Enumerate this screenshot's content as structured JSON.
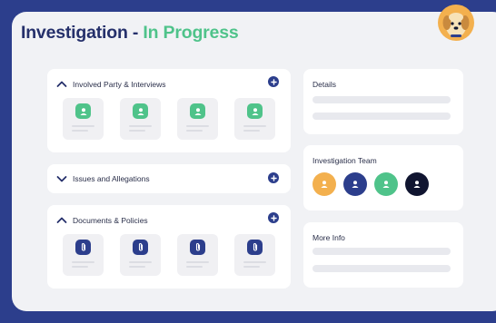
{
  "header": {
    "title": "Investigation - ",
    "status": "In Progress",
    "mascot_icon": "dog-avatar-icon"
  },
  "colors": {
    "background": "#2c3e8c",
    "panel": "#f1f2f5",
    "title": "#25306b",
    "status": "#4fc38a",
    "accent_navy": "#2c3e8c",
    "orange": "#f3b04e",
    "green": "#4fc38a",
    "dark": "#101530"
  },
  "sections": {
    "parties": {
      "label": "Involved Party & Interviews",
      "expanded": true,
      "tile_icon": "person-icon",
      "tile_count": 4
    },
    "issues": {
      "label": "Issues and Allegations",
      "expanded": false
    },
    "documents": {
      "label": "Documents & Policies",
      "expanded": true,
      "tile_icon": "paperclip-icon",
      "tile_count": 4
    }
  },
  "sidebar": {
    "details": {
      "label": "Details"
    },
    "team": {
      "label": "Investigation Team",
      "members": [
        {
          "icon": "person-icon",
          "color": "#f3b04e"
        },
        {
          "icon": "person-icon",
          "color": "#2c3e8c"
        },
        {
          "icon": "person-icon",
          "color": "#4fc38a"
        },
        {
          "icon": "person-icon",
          "color": "#101530"
        }
      ]
    },
    "more_info": {
      "label": "More Info"
    }
  }
}
